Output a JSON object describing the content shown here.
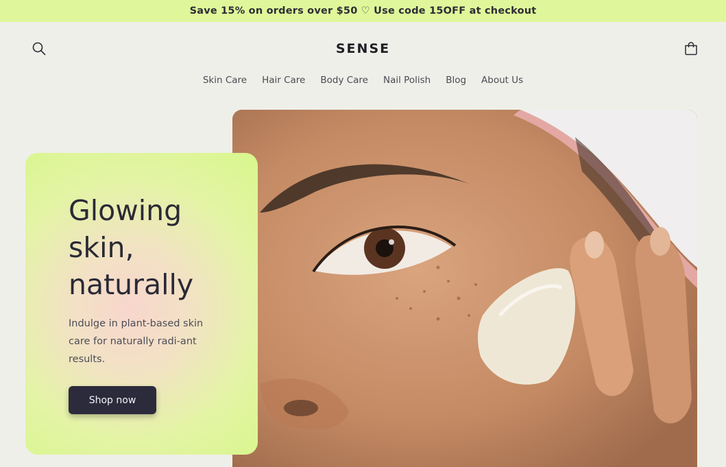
{
  "announcement": "Save 15% on orders over $50 ♡ Use code 15OFF at checkout",
  "header": {
    "logo": "SENSE",
    "search_icon": "search-icon",
    "cart_icon": "bag-icon"
  },
  "nav": {
    "items": [
      "Skin Care",
      "Hair Care",
      "Body Care",
      "Nail Polish",
      "Blog",
      "About Us"
    ]
  },
  "hero": {
    "headline": "Glowing skin, naturally",
    "subtext": "Indulge in plant-based skin care for naturally radi-ant results.",
    "cta_label": "Shop now"
  },
  "colors": {
    "announcement_bg": "#dff79a",
    "page_bg": "#efefe9",
    "cta_bg": "#2c2b3c",
    "card_accent": "#d8f68c"
  }
}
